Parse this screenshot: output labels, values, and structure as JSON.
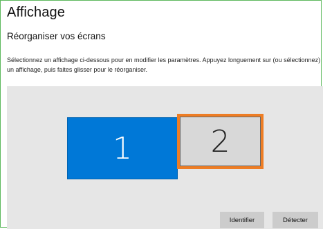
{
  "header": {
    "title": "Affichage",
    "subtitle": "Réorganiser vos écrans"
  },
  "description": "Sélectionnez un affichage ci-dessous pour en modifier les paramètres. Appuyez longuement sur (ou sélectionnez) un affichage, puis faites glisser pour le réorganiser.",
  "displays": [
    {
      "label": "1",
      "selected": false,
      "color": "#0078d7"
    },
    {
      "label": "2",
      "selected": true,
      "color": "#d8d8d8",
      "highlight": "#ee7d24"
    }
  ],
  "buttons": {
    "identify": "Identifier",
    "detect": "Détecter"
  }
}
